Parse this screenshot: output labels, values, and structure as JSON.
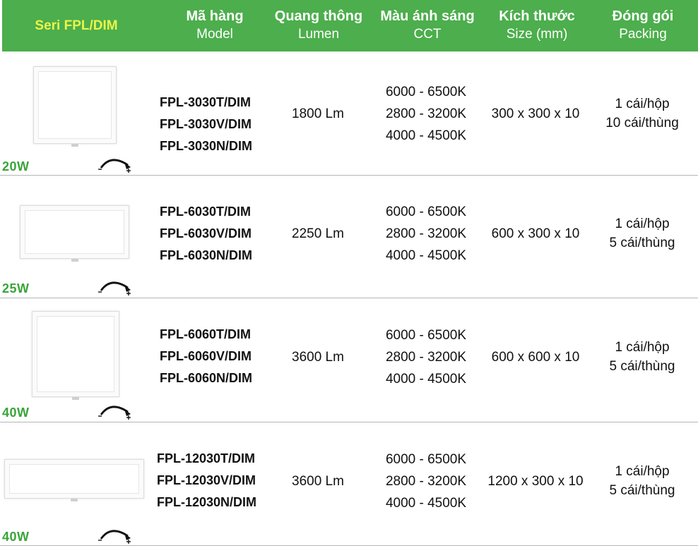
{
  "header": {
    "series": "Seri FPL/DIM",
    "columns": [
      {
        "vi": "Mã hàng",
        "en": "Model"
      },
      {
        "vi": "Quang thông",
        "en": "Lumen"
      },
      {
        "vi": "Màu ánh sáng",
        "en": "CCT"
      },
      {
        "vi": "Kích thước",
        "en": "Size (mm)"
      },
      {
        "vi": "Đóng gói",
        "en": "Packing"
      }
    ]
  },
  "rows": [
    {
      "watt": "20W",
      "models": [
        "FPL-3030T/DIM",
        "FPL-3030V/DIM",
        "FPL-3030N/DIM"
      ],
      "lumen": "1800 Lm",
      "cct": [
        "6000 - 6500K",
        "2800 - 3200K",
        "4000 - 4500K"
      ],
      "size": "300 x 300 x 10",
      "packing": [
        "1 cái/hộp",
        "10 cái/thùng"
      ]
    },
    {
      "watt": "25W",
      "models": [
        "FPL-6030T/DIM",
        "FPL-6030V/DIM",
        "FPL-6030N/DIM"
      ],
      "lumen": "2250 Lm",
      "cct": [
        "6000 - 6500K",
        "2800 - 3200K",
        "4000 - 4500K"
      ],
      "size": "600 x 300 x 10",
      "packing": [
        "1 cái/hộp",
        "5 cái/thùng"
      ]
    },
    {
      "watt": "40W",
      "models": [
        "FPL-6060T/DIM",
        "FPL-6060V/DIM",
        "FPL-6060N/DIM"
      ],
      "lumen": "3600 Lm",
      "cct": [
        "6000 - 6500K",
        "2800 - 3200K",
        "4000 - 4500K"
      ],
      "size": "600 x 600 x 10",
      "packing": [
        "1 cái/hộp",
        "5 cái/thùng"
      ]
    },
    {
      "watt": "40W",
      "models": [
        "FPL-12030T/DIM",
        "FPL-12030V/DIM",
        "FPL-12030N/DIM"
      ],
      "lumen": "3600 Lm",
      "cct": [
        "6000 - 6500K",
        "2800 - 3200K",
        "4000 - 4500K"
      ],
      "size": "1200 x 300 x 10",
      "packing": [
        "1 cái/hộp",
        "5 cái/thùng"
      ]
    }
  ]
}
